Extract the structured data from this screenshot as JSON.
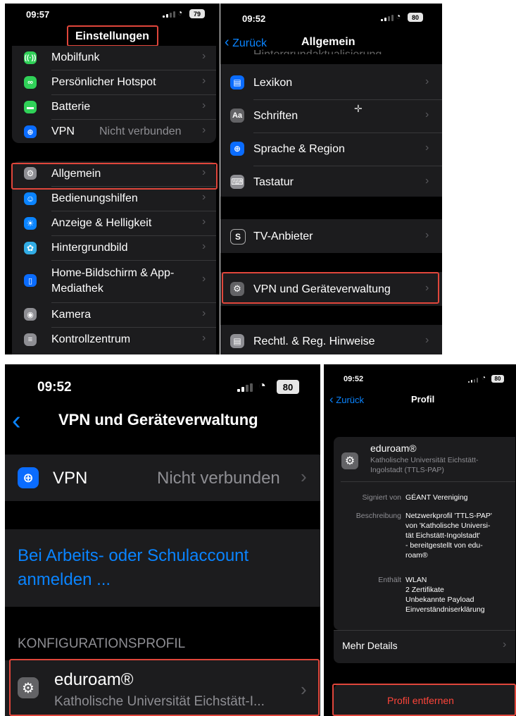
{
  "panel1": {
    "status": {
      "time": "09:57",
      "battery": "79"
    },
    "title": "Einstellungen",
    "group1": [
      {
        "label": "Mobilfunk",
        "icon": "antenna-icon",
        "color": "#30d158"
      },
      {
        "label": "Persönlicher Hotspot",
        "icon": "link-icon",
        "color": "#30d158"
      },
      {
        "label": "Batterie",
        "icon": "battery-icon",
        "color": "#30d158"
      },
      {
        "label": "VPN",
        "value": "Nicht verbunden",
        "icon": "globe-icon",
        "color": "#0a6cff"
      }
    ],
    "group2": [
      {
        "label": "Allgemein",
        "icon": "gear-icon",
        "color": "#8e8e93"
      },
      {
        "label": "Bedienungshilfen",
        "icon": "accessibility-icon",
        "color": "#0a84ff"
      },
      {
        "label": "Anzeige & Helligkeit",
        "icon": "sun-icon",
        "color": "#0a84ff"
      },
      {
        "label": "Hintergrundbild",
        "icon": "flower-icon",
        "color": "#32ade6"
      },
      {
        "label": "Home-Bildschirm & App-",
        "label2": "Mediathek",
        "icon": "phone-icon",
        "color": "#0a6cff"
      },
      {
        "label": "Kamera",
        "icon": "camera-icon",
        "color": "#8e8e93"
      },
      {
        "label": "Kontrollzentrum",
        "icon": "toggles-icon",
        "color": "#8e8e93"
      }
    ]
  },
  "panel2": {
    "status": {
      "time": "09:52",
      "battery": "80"
    },
    "back": "Zurück",
    "title": "Allgemein",
    "cut_off_label": "Hintergrundaktualisierung",
    "group1": [
      {
        "label": "Lexikon",
        "icon": "book-icon",
        "color": "#0a6cff"
      },
      {
        "label": "Schriften",
        "icon": "font-icon",
        "color": "#636366",
        "glyph": "Aa"
      },
      {
        "label": "Sprache & Region",
        "icon": "globe-icon",
        "color": "#0a6cff"
      },
      {
        "label": "Tastatur",
        "icon": "keyboard-icon",
        "color": "#8e8e93"
      }
    ],
    "tv": {
      "label": "TV-Anbieter",
      "icon": "tv-provider-icon",
      "glyph": "S"
    },
    "vpn_mgmt": {
      "label": "VPN und Geräteverwaltung",
      "icon": "gear-icon"
    },
    "legal": {
      "label": "Rechtl. & Reg. Hinweise",
      "icon": "document-icon"
    }
  },
  "panel3": {
    "status": {
      "time": "09:52",
      "battery": "80"
    },
    "title": "VPN und Geräteverwaltung",
    "vpn": {
      "label": "VPN",
      "value": "Nicht verbunden"
    },
    "signin": {
      "line1": "Bei Arbeits- oder Schulaccount",
      "line2": "anmelden ..."
    },
    "section_header": "KONFIGURATIONSPROFIL",
    "profile": {
      "name": "eduroam®",
      "subtitle": "Katholische Universität Eichstätt-I..."
    }
  },
  "panel4": {
    "status": {
      "time": "09:52",
      "battery": "80"
    },
    "back": "Zurück",
    "title": "Profil",
    "profile": {
      "name": "eduroam®",
      "org1": "Katholische Universität Eichstätt-",
      "org2": "Ingolstadt (TTLS-PAP)"
    },
    "details": [
      {
        "key": "Signiert von",
        "lines": [
          "GÉANT Vereniging"
        ]
      },
      {
        "key": "Beschreibung",
        "lines": [
          "Netzwerkprofil 'TTLS-PAP'",
          "von 'Katholische Universi-",
          "tät Eichstätt-Ingolstadt'",
          "- bereitgestellt von edu-",
          "roam®"
        ]
      },
      {
        "key": "Enthält",
        "lines": [
          "WLAN",
          "2 Zertifikate",
          "Unbekannte Payload",
          "Einverständniserklärung"
        ]
      }
    ],
    "more_details": "Mehr Details",
    "remove": "Profil entfernen"
  },
  "colors": {
    "accent": "#0a84ff",
    "highlight": "#e0463b",
    "destructive": "#ff453a"
  }
}
